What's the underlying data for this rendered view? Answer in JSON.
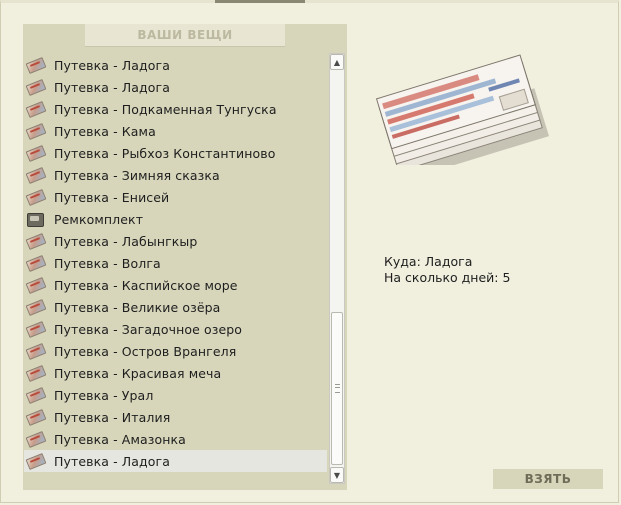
{
  "panel": {
    "title": "ВАШИ ВЕЩИ"
  },
  "items": [
    {
      "label": "Путевка - Ладога",
      "icon": "ticket-icon"
    },
    {
      "label": "Путевка - Ладога",
      "icon": "ticket-icon"
    },
    {
      "label": "Путевка - Подкаменная Тунгуска",
      "icon": "ticket-icon"
    },
    {
      "label": "Путевка - Кама",
      "icon": "ticket-icon"
    },
    {
      "label": "Путевка - Рыбхоз Константиново",
      "icon": "ticket-icon"
    },
    {
      "label": "Путевка - Зимняя сказка",
      "icon": "ticket-icon"
    },
    {
      "label": "Путевка - Енисей",
      "icon": "ticket-icon"
    },
    {
      "label": "Ремкомплект",
      "icon": "repair-kit-icon"
    },
    {
      "label": "Путевка - Лабынгкыр",
      "icon": "ticket-icon"
    },
    {
      "label": "Путевка - Волга",
      "icon": "ticket-icon"
    },
    {
      "label": "Путевка - Каспийское море",
      "icon": "ticket-icon"
    },
    {
      "label": "Путевка - Великие озёра",
      "icon": "ticket-icon"
    },
    {
      "label": "Путевка - Загадочное озеро",
      "icon": "ticket-icon"
    },
    {
      "label": "Путевка - Остров Врангеля",
      "icon": "ticket-icon"
    },
    {
      "label": "Путевка - Красивая меча",
      "icon": "ticket-icon"
    },
    {
      "label": "Путевка - Урал",
      "icon": "ticket-icon"
    },
    {
      "label": "Путевка - Италия",
      "icon": "ticket-icon"
    },
    {
      "label": "Путевка - Амазонка",
      "icon": "ticket-icon"
    },
    {
      "label": "Путевка - Ладога",
      "icon": "ticket-icon",
      "selected": true
    }
  ],
  "details": {
    "destination_label": "Куда:",
    "destination_value": "Ладога",
    "days_label": "На сколько дней:",
    "days_value": "5"
  },
  "buttons": {
    "take_label": "ВЗЯТЬ"
  },
  "colors": {
    "panel_bg": "#d7d6bb",
    "page_bg": "#f1f0df",
    "selected_row": "#e6e6e0"
  }
}
